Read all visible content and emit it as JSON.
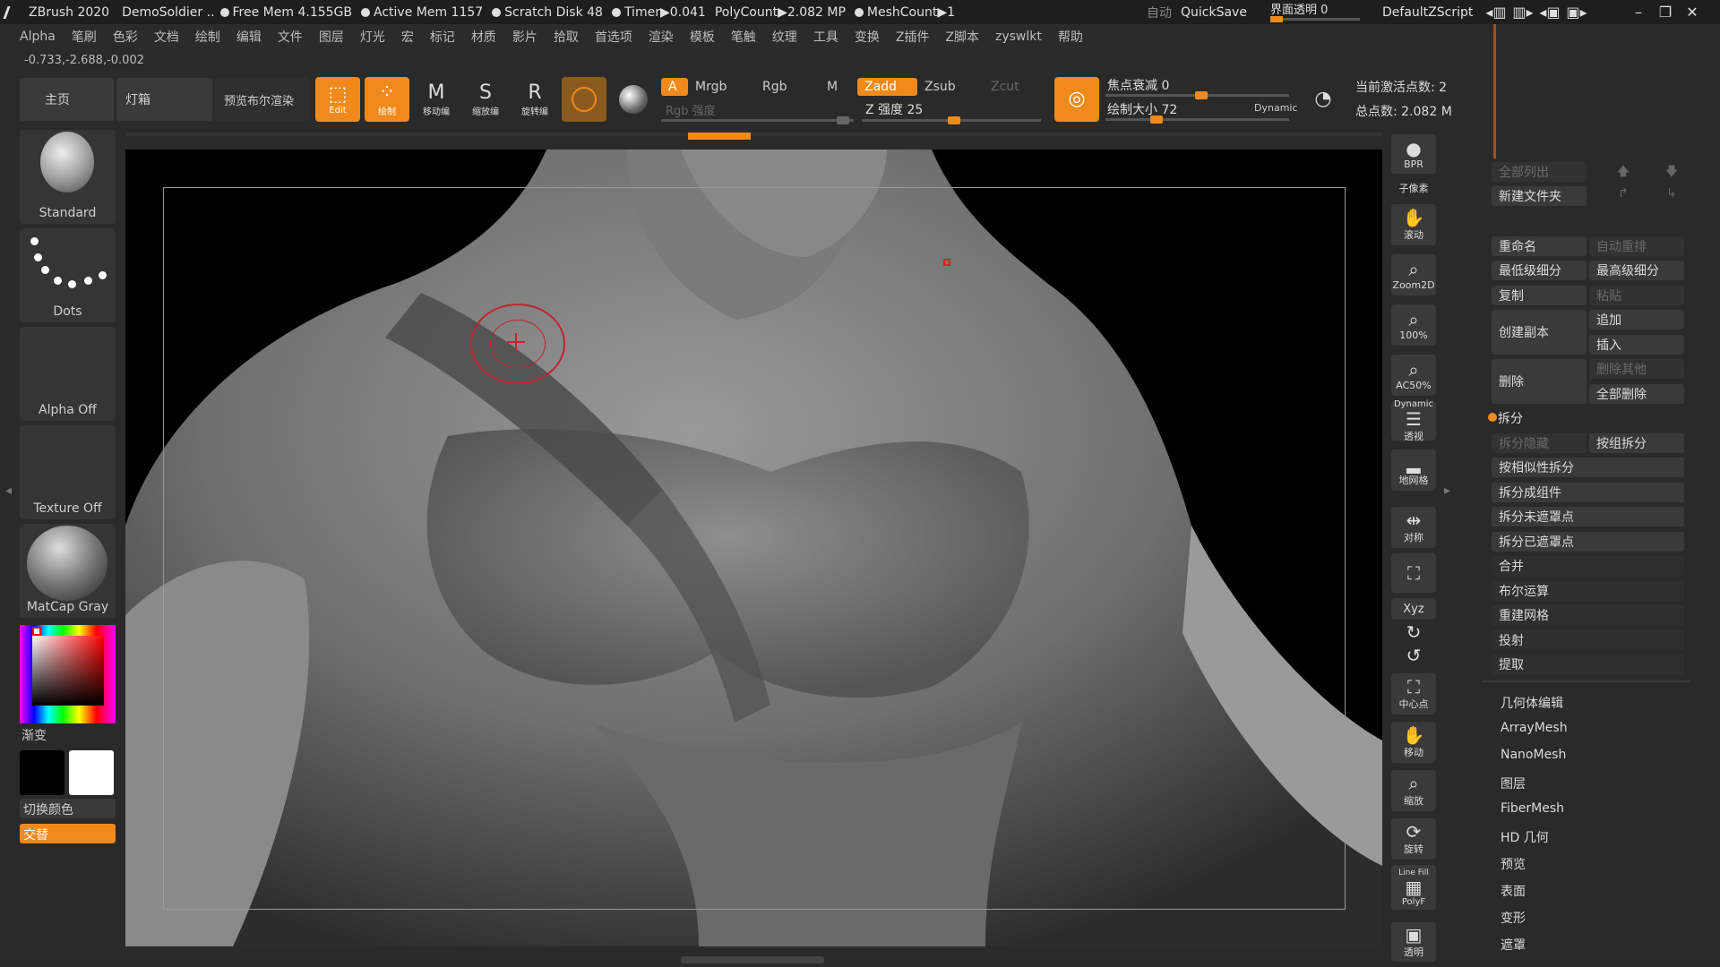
{
  "titlebar": {
    "app": "ZBrush 2020",
    "project": "DemoSoldier ..",
    "free_mem": "Free Mem 4.155GB",
    "active_mem": "Active Mem 1157",
    "scratch": "Scratch Disk 48",
    "timer": "Timer▶0.041",
    "polycount": "PolyCount▶2.082 MP",
    "meshcount": "MeshCount▶1",
    "auto": "自动",
    "quicksave": "QuickSave",
    "ui_transparency": "界面透明 0",
    "script": "DefaultZScript"
  },
  "menu": [
    "Alpha",
    "笔刷",
    "色彩",
    "文档",
    "绘制",
    "编辑",
    "文件",
    "图层",
    "灯光",
    "宏",
    "标记",
    "材质",
    "影片",
    "拾取",
    "首选项",
    "渲染",
    "模板",
    "笔触",
    "纹理",
    "工具",
    "变换",
    "Z插件",
    "Z脚本",
    "zyswlkt",
    "帮助"
  ],
  "coords": "-0.733,-2.688,-0.002",
  "toolbar": {
    "home": "主页",
    "lightbox": "灯箱",
    "preview_bool": "预览布尔渲染",
    "edit": "Edit",
    "draw": "绘制",
    "move": "移动编",
    "scale": "缩放编",
    "rotate": "旋转编",
    "a": "A",
    "mrgb": "Mrgb",
    "rgb": "Rgb",
    "m": "M",
    "rgb_intensity": "Rgb 强度",
    "zadd": "Zadd",
    "zsub": "Zsub",
    "zcut": "Zcut",
    "z_intensity": "Z 强度 25",
    "focal_shift": "焦点衰减 0",
    "draw_size": "绘制大小 72",
    "dynamic": "Dynamic",
    "active_points": "当前激活点数: 2",
    "total_points": "总点数: 2.082 M"
  },
  "left": {
    "brush": "Standard",
    "stroke": "Dots",
    "alpha": "Alpha Off",
    "texture": "Texture Off",
    "material": "MatCap Gray",
    "gradient": "渐变",
    "switch_color": "切换颜色",
    "alternate": "交替"
  },
  "rtool": [
    "BPR",
    "子像素",
    "滚动",
    "Zoom2D",
    "100%",
    "AC50%",
    "Dynamic",
    "透视",
    "地网格",
    "对称",
    "",
    "Xyz",
    "",
    "",
    "中心点",
    "移动",
    "缩放",
    "旋转",
    "Line Fill",
    "PolyF",
    "透明"
  ],
  "subtool": {
    "list_all": "全部列出",
    "new_folder": "新建文件夹",
    "rename": "重命名",
    "auto_reorder": "自动重排",
    "lowest_sub": "最低级细分",
    "highest_sub": "最高级细分",
    "copy": "复制",
    "paste": "粘贴",
    "duplicate": "创建副本",
    "append": "追加",
    "insert": "插入",
    "delete": "删除",
    "del_other": "删除其他",
    "del_all": "全部删除",
    "split": "拆分",
    "split_hidden": "拆分隐藏",
    "groups_split": "按组拆分",
    "split_similar": "按相似性拆分",
    "split_parts": "拆分成组件",
    "split_unmasked": "拆分未遮罩点",
    "split_masked": "拆分已遮罩点",
    "merge": "合并",
    "boolean": "布尔运算",
    "remesh": "重建网格",
    "project": "投射",
    "extract": "提取"
  },
  "tool_sections": [
    "几何体编辑",
    "ArrayMesh",
    "NanoMesh",
    "图层",
    "FiberMesh",
    "HD 几何",
    "预览",
    "表面",
    "变形",
    "遮罩"
  ],
  "colors": {
    "accent": "#f08a1d"
  }
}
